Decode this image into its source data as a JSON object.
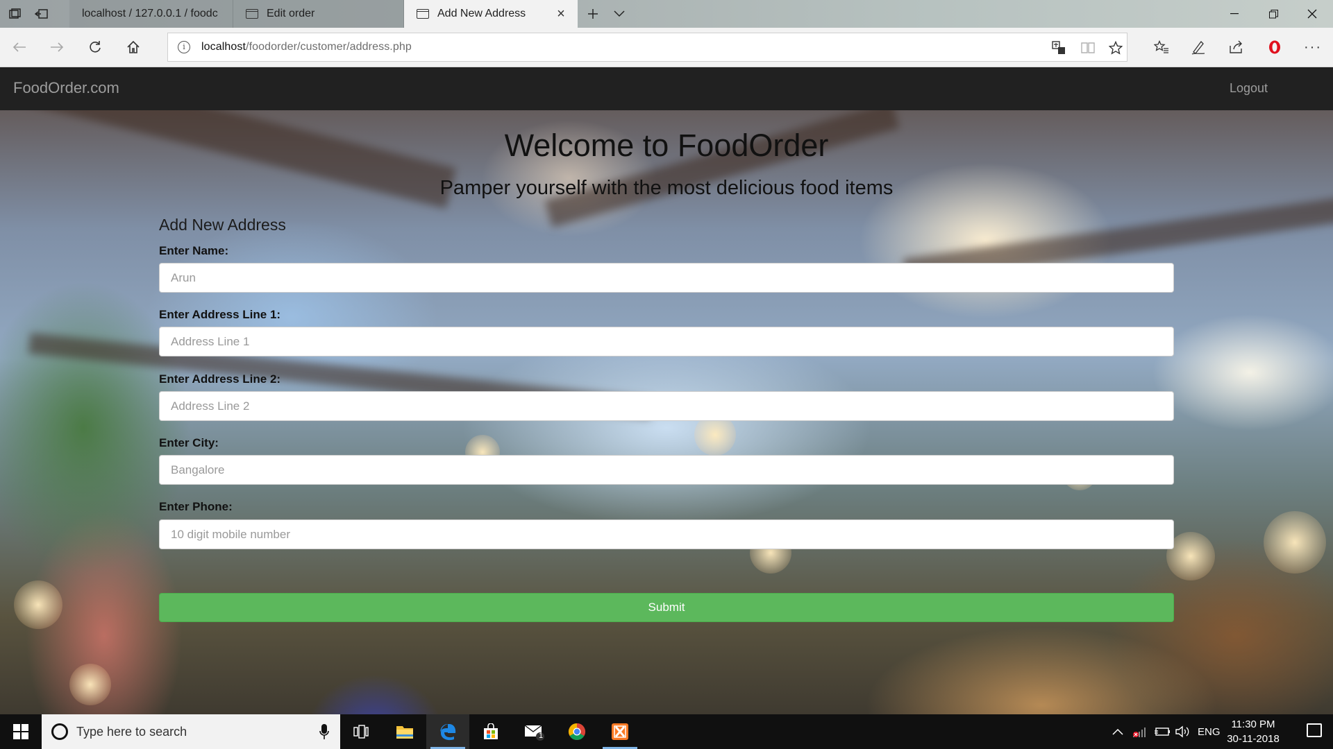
{
  "browser": {
    "tabs": [
      {
        "title": "localhost / 127.0.0.1 / foodc",
        "active": false
      },
      {
        "title": "Edit order",
        "active": false
      },
      {
        "title": "Add New Address",
        "active": true
      }
    ],
    "url_host": "localhost",
    "url_path": "/foodorder/customer/address.php"
  },
  "site": {
    "brand": "FoodOrder.com",
    "logout_label": "Logout"
  },
  "hero": {
    "title": "Welcome to FoodOrder",
    "subtitle": "Pamper yourself with the most delicious food items"
  },
  "form": {
    "title": "Add New Address",
    "fields": [
      {
        "label": "Enter Name:",
        "placeholder": "Arun",
        "value": ""
      },
      {
        "label": "Enter Address Line 1:",
        "placeholder": "Address Line 1",
        "value": ""
      },
      {
        "label": "Enter Address Line 2:",
        "placeholder": "Address Line 2",
        "value": ""
      },
      {
        "label": "Enter City:",
        "placeholder": "Bangalore",
        "value": ""
      },
      {
        "label": "Enter Phone:",
        "placeholder": "10 digit mobile number",
        "value": ""
      }
    ],
    "submit_label": "Submit"
  },
  "taskbar": {
    "search_placeholder": "Type here to search",
    "mail_badge": "1",
    "language": "ENG",
    "time": "11:30 PM",
    "date": "30-11-2018"
  },
  "colors": {
    "submit": "#5cb85c",
    "header": "#212121",
    "header_text": "#9d9d9d"
  }
}
